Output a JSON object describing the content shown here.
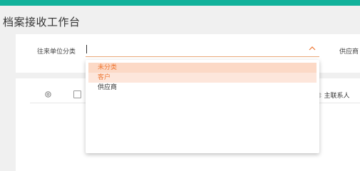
{
  "page": {
    "title": "档案接收工作台"
  },
  "filter": {
    "unit_category_label": "往来单位分类",
    "supplier_label": "供应商",
    "options": [
      "未分类",
      "客户",
      "供应商"
    ]
  },
  "table": {
    "contact_header": "主联系人",
    "sort_glyph": "⇕"
  },
  "colors": {
    "accent": "#12b29b",
    "selected_text": "#ee7733",
    "selected_bg": "#fcd9c6",
    "hover_bg": "#fde6db"
  }
}
